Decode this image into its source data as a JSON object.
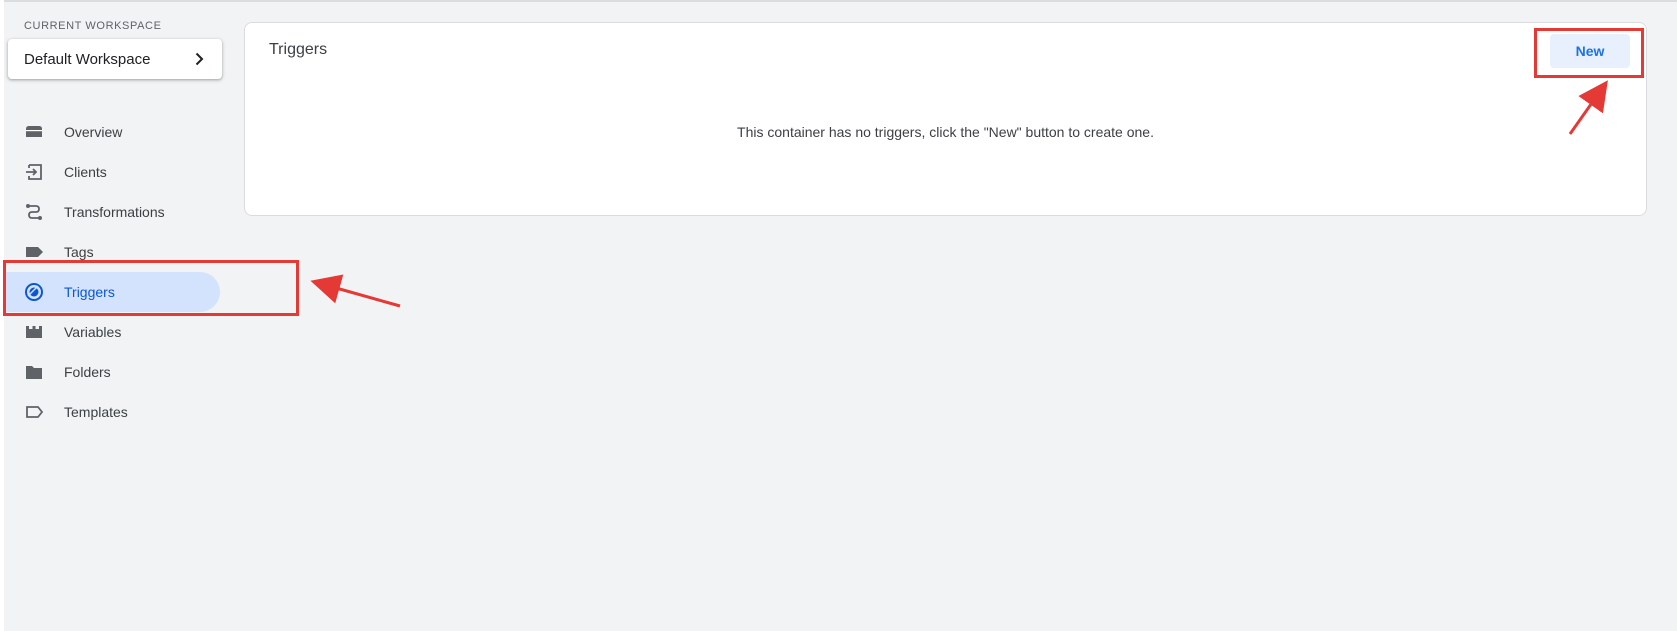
{
  "workspace": {
    "label": "CURRENT WORKSPACE",
    "name": "Default Workspace",
    "chevron_icon": "chevron-right-icon"
  },
  "nav": {
    "items": [
      {
        "label": "Overview",
        "icon": "overview-icon"
      },
      {
        "label": "Clients",
        "icon": "clients-icon"
      },
      {
        "label": "Transformations",
        "icon": "transformations-icon"
      },
      {
        "label": "Tags",
        "icon": "tag-icon"
      },
      {
        "label": "Triggers",
        "icon": "triggers-icon",
        "active": true
      },
      {
        "label": "Variables",
        "icon": "variables-icon"
      },
      {
        "label": "Folders",
        "icon": "folder-icon"
      },
      {
        "label": "Templates",
        "icon": "template-icon"
      }
    ]
  },
  "main": {
    "title": "Triggers",
    "new_button": "New",
    "empty_message": "This container has no triggers, click the \"New\" button to create one."
  },
  "colors": {
    "accent": "#1a73e8",
    "active_nav_bg": "#d3e3fd",
    "annotation": "#e53935",
    "background": "#f1f3f4"
  }
}
